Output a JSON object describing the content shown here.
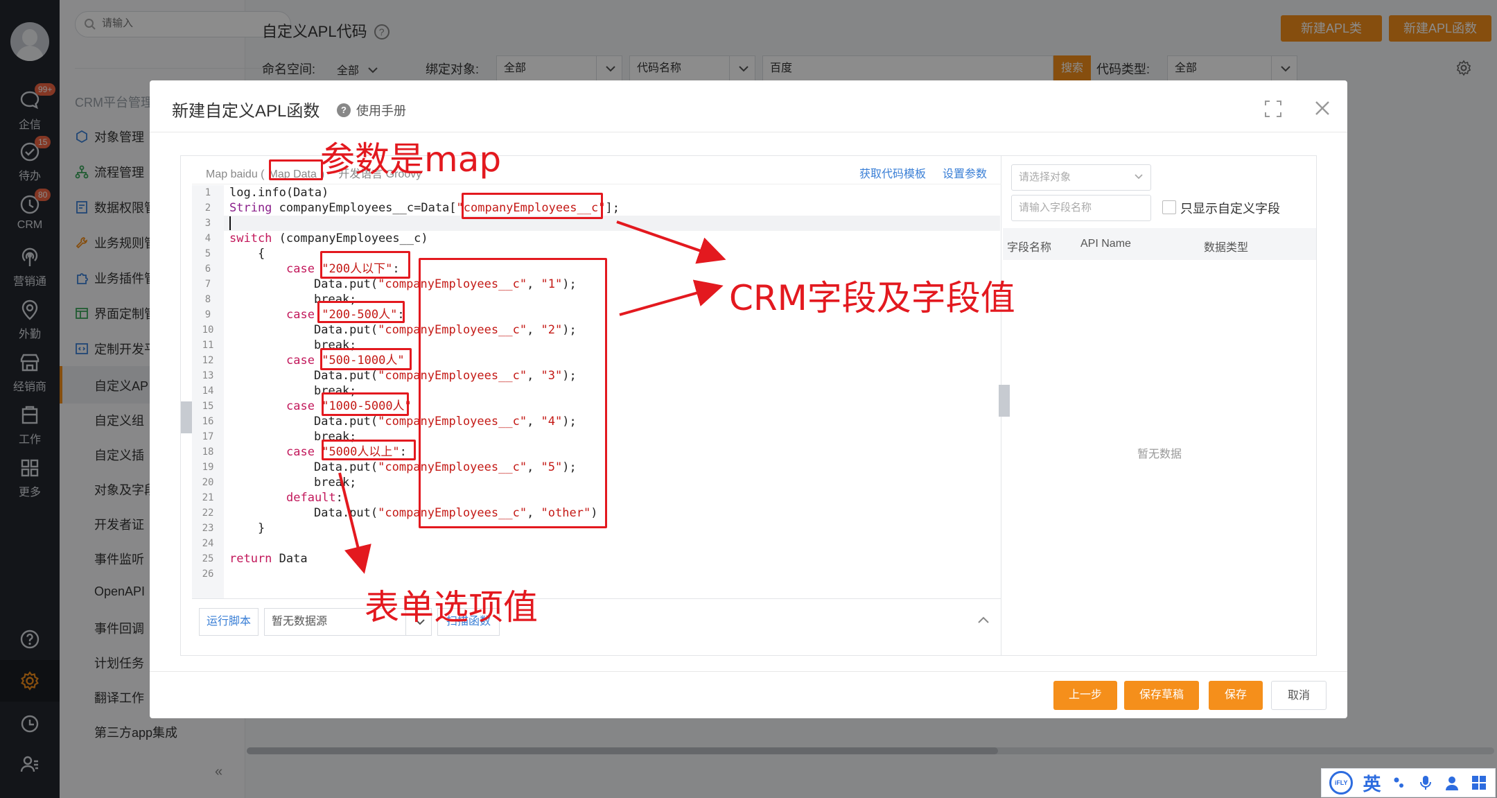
{
  "rail": {
    "items": [
      {
        "label": "企信",
        "badge": "99+",
        "icon": "chat-bubble-icon"
      },
      {
        "label": "待办",
        "badge": "15",
        "icon": "check-circle-icon"
      },
      {
        "label": "CRM",
        "badge": "80",
        "icon": "clock-icon"
      },
      {
        "label": "营销通",
        "icon": "broadcast-icon"
      },
      {
        "label": "外勤",
        "icon": "location-pin-icon"
      },
      {
        "label": "经销商",
        "icon": "store-icon"
      },
      {
        "label": "工作",
        "icon": "clipboard-icon"
      },
      {
        "label": "更多",
        "icon": "grid-icon"
      }
    ]
  },
  "nav": {
    "search_placeholder": "请输入",
    "group_title": "CRM平台管理",
    "items": [
      "对象管理",
      "流程管理",
      "数据权限管",
      "业务规则管",
      "业务插件管",
      "界面定制管",
      "定制开发平"
    ],
    "subitems": [
      "自定义AP",
      "自定义组",
      "自定义插",
      "对象及字段",
      "开发者证",
      "事件监听",
      "OpenAPI",
      "事件回调",
      "计划任务",
      "翻译工作",
      "第三方app集成"
    ],
    "collapse": "«"
  },
  "page": {
    "title": "自定义APL代码",
    "help": "?",
    "btn_new_class": "新建APL类",
    "btn_new_func": "新建APL函数",
    "namespace_label": "命名空间:",
    "namespace_value": "全部",
    "bind_label": "绑定对象:",
    "bind_value": "全部",
    "code_name_select": "代码名称",
    "search_value": "百度",
    "search_btn": "搜索",
    "code_type_label": "代码类型:",
    "code_type_value": "全部"
  },
  "modal": {
    "title": "新建自定义APL函数",
    "manual": "使用手册",
    "manual_icon": "?",
    "tabs": [
      "Map baidu (",
      "Map Data",
      ")",
      "开发语言 Groovy"
    ],
    "link_template": "获取代码模板",
    "link_params": "设置参数",
    "lines": [
      {
        "n": "1"
      },
      {
        "n": "2"
      },
      {
        "n": "3"
      },
      {
        "n": "4"
      },
      {
        "n": "5"
      },
      {
        "n": "6"
      },
      {
        "n": "7"
      },
      {
        "n": "8"
      },
      {
        "n": "9"
      },
      {
        "n": "10"
      },
      {
        "n": "11"
      },
      {
        "n": "12"
      },
      {
        "n": "13"
      },
      {
        "n": "14"
      },
      {
        "n": "15"
      },
      {
        "n": "16"
      },
      {
        "n": "17"
      },
      {
        "n": "18"
      },
      {
        "n": "19"
      },
      {
        "n": "20"
      },
      {
        "n": "21"
      },
      {
        "n": "22"
      },
      {
        "n": "23"
      },
      {
        "n": "24"
      },
      {
        "n": "25"
      },
      {
        "n": "26"
      }
    ],
    "code": {
      "l1": "log.info(Data)",
      "l2a": "String",
      "l2b": " companyEmployees__c=Data[",
      "l2c": "\"companyEmployees__c\"",
      "l2d": "];",
      "l4a": "switch",
      "l4b": " (companyEmployees__c)",
      "l5": "    {",
      "cases": [
        {
          "kw": "case",
          "val": "\"200人以下\"",
          "put": "\"1\""
        },
        {
          "kw": "case",
          "val": "\"200-500人\"",
          "put": "\"2\""
        },
        {
          "kw": "case",
          "val": "\"500-1000人\"",
          "put": "\"3\""
        },
        {
          "kw": "case",
          "val": "\"1000-5000人\"",
          "put": "\"4\""
        },
        {
          "kw": "case",
          "val": "\"5000人以上\"",
          "put": "\"5\""
        }
      ],
      "put_prefix": "Data.put(",
      "put_field": "\"companyEmployees__c\"",
      "put_sep": ", ",
      "put_suffix": ");",
      "brk": "break;",
      "default_kw": "default",
      "default_colon": ":",
      "default_put": "\"other\"",
      "default_suffix": ")",
      "close_brace": "    }",
      "ret_kw": "return",
      "ret_val": " Data"
    },
    "run_btn": "运行脚本",
    "datasource": "暂无数据源",
    "scan_btn": "扫描函数",
    "obj_placeholder": "请选择对象",
    "field_placeholder": "请输入字段名称",
    "only_custom": "只显示自定义字段",
    "cols": [
      "字段名称",
      "API Name",
      "数据类型"
    ],
    "empty": "暂无数据",
    "btn_prev": "上一步",
    "btn_draft": "保存草稿",
    "btn_save": "保存",
    "btn_cancel": "取消"
  },
  "annotations": {
    "params_is_map": "参数是map",
    "crm_fields": "CRM字段及字段值",
    "form_options": "表单选项值"
  },
  "ime": {
    "logo": "iFLY",
    "lang": "英"
  },
  "colors": {
    "accent": "#f58f1b",
    "annotation": "#e3191f",
    "link": "#3a7fd6",
    "rail": "#23272f"
  }
}
